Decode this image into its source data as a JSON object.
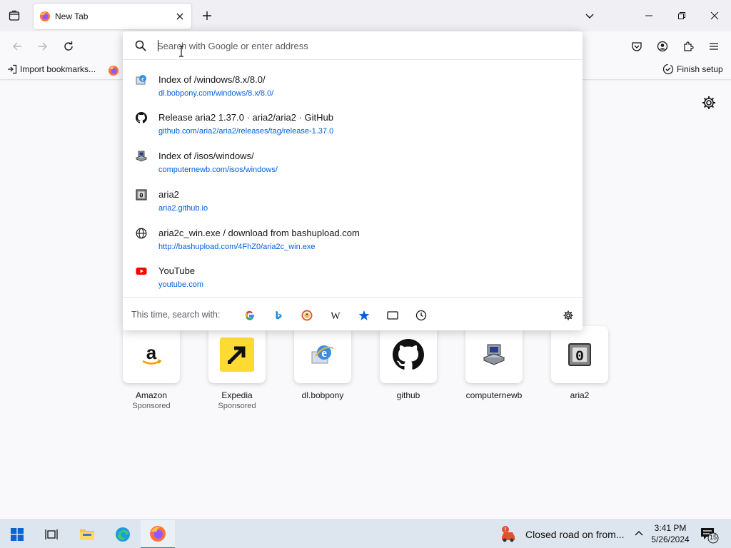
{
  "tab": {
    "title": "New Tab"
  },
  "bookmarks": {
    "import_label": "Import bookmarks...",
    "finish_setup": "Finish setup"
  },
  "urlbar": {
    "placeholder": "Search with Google or enter address",
    "results": [
      {
        "title": "Index of /windows/8.x/8.0/",
        "url": "dl.bobpony.com/windows/8.x/8.0/",
        "icon": "bobpony-icon"
      },
      {
        "title": "Release aria2 1.37.0 · aria2/aria2 · GitHub",
        "url": "github.com/aria2/aria2/releases/tag/release-1.37.0",
        "icon": "github-icon"
      },
      {
        "title": "Index of /isos/windows/",
        "url": "computernewb.com/isos/windows/",
        "icon": "computernewb-icon"
      },
      {
        "title": "aria2",
        "url": "aria2.github.io",
        "icon": "aria2-icon"
      },
      {
        "title": "aria2c_win.exe / download from bashupload.com",
        "url": "http://bashupload.com/4FhZ0/aria2c_win.exe",
        "icon": "globe-icon"
      },
      {
        "title": "YouTube",
        "url": "youtube.com",
        "icon": "youtube-icon"
      }
    ],
    "oneoff_label": "This time, search with:"
  },
  "topsites": [
    {
      "label": "Amazon",
      "sponsored": "Sponsored"
    },
    {
      "label": "Expedia",
      "sponsored": "Sponsored"
    },
    {
      "label": "dl.bobpony",
      "sponsored": ""
    },
    {
      "label": "github",
      "sponsored": ""
    },
    {
      "label": "computernewb",
      "sponsored": ""
    },
    {
      "label": "aria2",
      "sponsored": ""
    }
  ],
  "taskbar": {
    "news": "Closed road on from...",
    "time": "3:41 PM",
    "date": "5/26/2024",
    "notifications": "15"
  }
}
